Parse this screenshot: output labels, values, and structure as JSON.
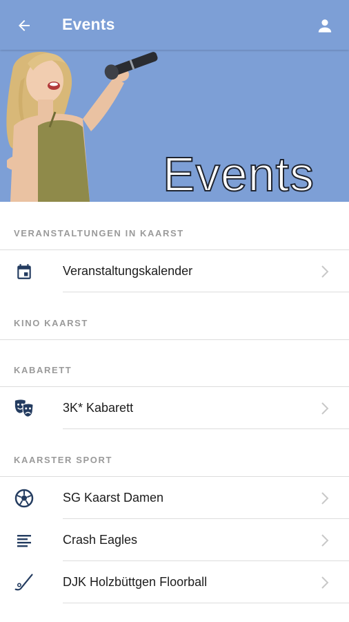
{
  "appbar": {
    "title": "Events",
    "back_icon": "arrow-left-icon",
    "user_icon": "account-icon",
    "color": "#7d9fd6"
  },
  "hero": {
    "text": "Events"
  },
  "sections": [
    {
      "header": "VERANSTALTUNGEN IN KAARST",
      "items": [
        {
          "label": "Veranstaltungskalender",
          "icon": "calendar-icon"
        }
      ]
    },
    {
      "header": "KINO KAARST",
      "items": []
    },
    {
      "header": "KABARETT",
      "items": [
        {
          "label": "3K* Kabarett",
          "icon": "theater-masks-icon"
        }
      ]
    },
    {
      "header": "KAARSTER SPORT",
      "items": [
        {
          "label": "SG Kaarst Damen",
          "icon": "soccer-ball-icon"
        },
        {
          "label": "Crash Eagles",
          "icon": "list-lines-icon"
        },
        {
          "label": "DJK Holzbüttgen Floorball",
          "icon": "hockey-stick-icon"
        }
      ]
    }
  ],
  "colors": {
    "icon": "#243c60",
    "header_text": "#9a9a9a",
    "divider": "#dcdcdc"
  }
}
